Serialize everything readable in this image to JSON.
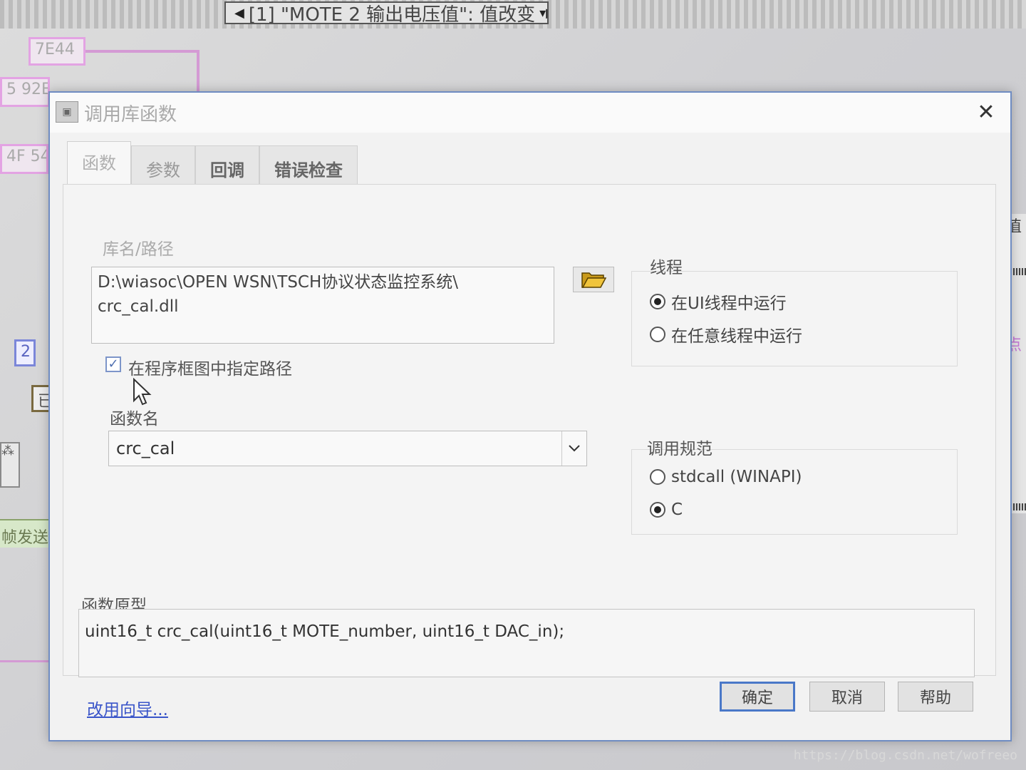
{
  "background": {
    "case_selector_text": "[1] \"MOTE 2 输出电压值\": 值改变",
    "const_top": "7E44",
    "const_mid": "5 92E",
    "const_mid2": "4F 54",
    "index_const": "2",
    "small_const": "已",
    "strip_text": "帧发送",
    "right_text_1": "值",
    "right_text_2": "点"
  },
  "dialog": {
    "title": "调用库函数",
    "close_glyph": "✕"
  },
  "tabs": [
    {
      "label": "函数"
    },
    {
      "label": "参数"
    },
    {
      "label": "回调"
    },
    {
      "label": "错误检查"
    }
  ],
  "library": {
    "label": "库名/路径",
    "path_line1": "D:\\wiasoc\\OPEN WSN\\TSCH协议状态监控系统\\",
    "path_line2": "crc_cal.dll",
    "checkbox_label": "在程序框图中指定路径",
    "checkbox_checked": true
  },
  "function": {
    "label": "函数名",
    "value": "crc_cal"
  },
  "thread": {
    "title": "线程",
    "options": [
      {
        "label": "在UI线程中运行",
        "selected": true
      },
      {
        "label": "在任意线程中运行",
        "selected": false
      }
    ]
  },
  "calling_convention": {
    "title": "调用规范",
    "options": [
      {
        "label": "stdcall (WINAPI)",
        "selected": false
      },
      {
        "label": "C",
        "selected": true
      }
    ]
  },
  "prototype": {
    "label": "函数原型",
    "value": "uint16_t crc_cal(uint16_t MOTE_number, uint16_t DAC_in);"
  },
  "footer": {
    "wizard_link": "改用向导...",
    "ok": "确定",
    "cancel": "取消",
    "help": "帮助"
  },
  "watermark": "https://blog.csdn.net/wofreeo",
  "colors": {
    "accent": "#4a78c8",
    "link": "#3a55c9",
    "wire": "#d49ad4"
  }
}
